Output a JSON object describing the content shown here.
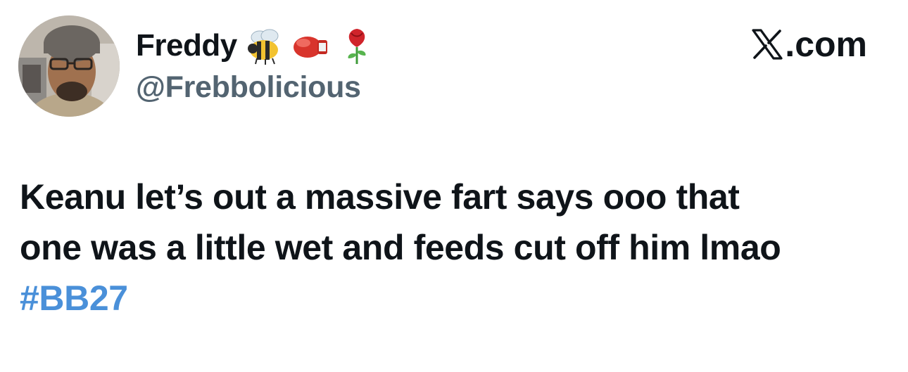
{
  "tweet": {
    "author": {
      "display_name": "Freddy",
      "handle": "@Frebbolicious",
      "name_emojis": [
        "bee-emoji",
        "boxing-glove-emoji",
        "rose-emoji"
      ]
    },
    "brand": {
      "logo_icon": "x-logo-icon",
      "label": ".com"
    },
    "text_lines": [
      "Keanu let’s out a massive fart says ooo that",
      "one was a little wet and feeds cut off him lmao"
    ],
    "hashtag": "#BB27"
  },
  "colors": {
    "text_primary": "#0f1419",
    "text_secondary": "#536471",
    "hashtag": "#4a90d9",
    "background": "#ffffff"
  }
}
